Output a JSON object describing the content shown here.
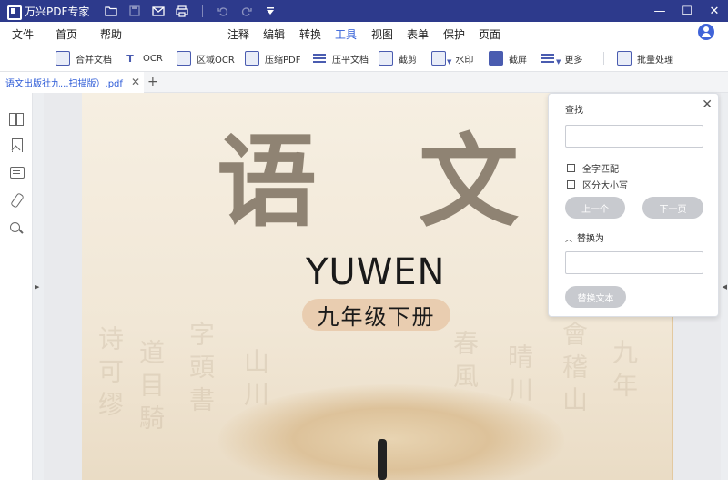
{
  "titlebar": {
    "app_title": "万兴PDF专家",
    "quick_icons": [
      "folder-icon",
      "save-icon",
      "mail-icon",
      "print-icon",
      "undo-icon",
      "redo-icon",
      "customize-icon"
    ],
    "window": {
      "minimize": "—",
      "maximize": "☐",
      "close": "✕"
    }
  },
  "menubar": {
    "left": [
      "文件",
      "首页",
      "帮助"
    ],
    "center": [
      "注释",
      "编辑",
      "转换",
      "工具",
      "视图",
      "表单",
      "保护",
      "页面"
    ],
    "active": "工具"
  },
  "toolbar": {
    "tools": [
      {
        "label": "合并文档",
        "icon": "merge-icon"
      },
      {
        "label": "OCR",
        "icon": "ocr-icon"
      },
      {
        "label": "区域OCR",
        "icon": "area-ocr-icon"
      },
      {
        "label": "压缩PDF",
        "icon": "compress-icon"
      },
      {
        "label": "压平文档",
        "icon": "flatten-icon"
      },
      {
        "label": "截剪",
        "icon": "crop-icon"
      },
      {
        "label": "水印",
        "icon": "watermark-icon"
      },
      {
        "label": "截屏",
        "icon": "screenshot-icon"
      },
      {
        "label": "更多",
        "icon": "more-icon"
      },
      {
        "label": "批量处理",
        "icon": "batch-icon"
      }
    ]
  },
  "tabs": {
    "document": "语文出版社九...扫描版）.pdf",
    "close": "✕",
    "add": "+"
  },
  "sidebar": {
    "icons": [
      "pages-icon",
      "bookmark-icon",
      "comment-icon",
      "attachment-icon",
      "search-icon"
    ]
  },
  "page": {
    "title_char_1": "语",
    "title_char_2": "文",
    "subtitle": "YUWEN",
    "grade": "九年级下册",
    "background_colors": {
      "paper": "#f4ecdd",
      "pill": "#e9cdb0",
      "title_ink": "#8f8373"
    }
  },
  "find_panel": {
    "title": "查找",
    "close": "✕",
    "search_value": "",
    "options": [
      "全字匹配",
      "区分大小写"
    ],
    "prev": "上一个",
    "next": "下一页",
    "replace_header": "替换为",
    "replace_value": "",
    "replace_button": "替换文本"
  },
  "colors": {
    "titlebar": "#2d3a8c",
    "accent": "#2d5bd7",
    "disabled_button": "#c8cacf"
  }
}
